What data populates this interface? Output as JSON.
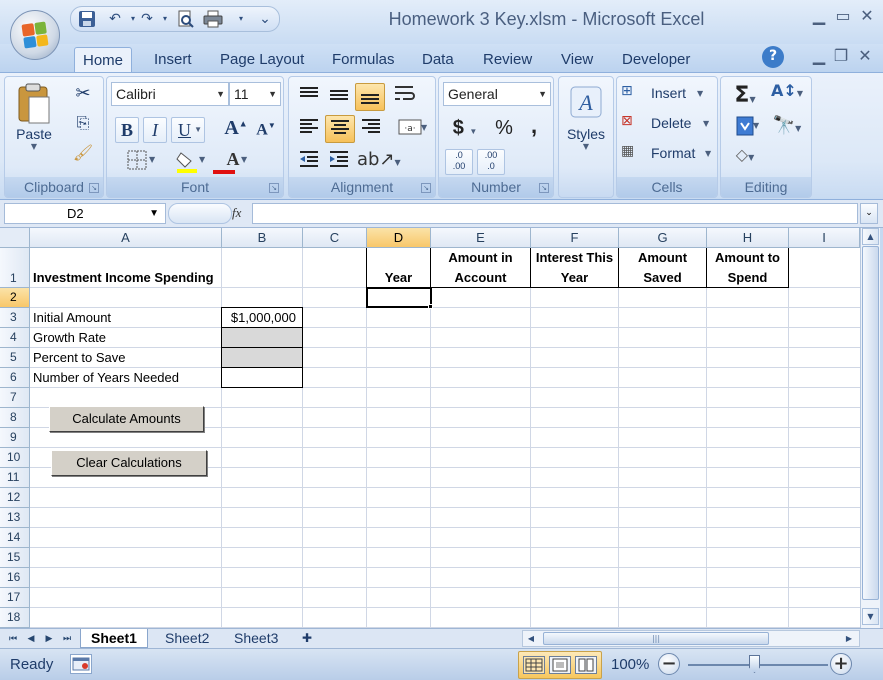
{
  "window": {
    "title": "Homework 3 Key.xlsm - Microsoft Excel"
  },
  "ribbon_tabs": [
    "Home",
    "Insert",
    "Page Layout",
    "Formulas",
    "Data",
    "Review",
    "View",
    "Developer"
  ],
  "ribbon": {
    "clipboard": {
      "label": "Clipboard",
      "paste": "Paste"
    },
    "font": {
      "label": "Font",
      "name": "Calibri",
      "size": "11",
      "bold": "B",
      "italic": "I",
      "underline": "U"
    },
    "alignment": {
      "label": "Alignment"
    },
    "number": {
      "label": "Number",
      "format": "General",
      "currency": "$",
      "percent": "%",
      "comma": ","
    },
    "styles": {
      "label": "Styles"
    },
    "cells": {
      "label": "Cells",
      "insert": "Insert",
      "delete": "Delete",
      "format": "Format"
    },
    "editing": {
      "label": "Editing"
    }
  },
  "formula_bar": {
    "name_box": "D2",
    "fx": "fx",
    "value": ""
  },
  "columns": [
    "A",
    "B",
    "C",
    "D",
    "E",
    "F",
    "G",
    "H",
    "I"
  ],
  "rows": [
    "1",
    "2",
    "3",
    "4",
    "5",
    "6",
    "7",
    "8",
    "9",
    "10",
    "11",
    "12",
    "13",
    "14",
    "15",
    "16",
    "17",
    "18"
  ],
  "cells": {
    "A1": "Investment Income Spending",
    "A3": "Initial Amount",
    "A4": "Growth Rate",
    "A5": "Percent to Save",
    "A6": "Number of Years Needed",
    "B3": "$1,000,000",
    "D1": "Year",
    "E1_line1": "Amount in",
    "E1_line2": "Account",
    "F1_line1": "Interest This",
    "F1_line2": "Year",
    "G1_line1": "Amount",
    "G1_line2": "Saved",
    "H1_line1": "Amount to",
    "H1_line2": "Spend"
  },
  "buttons": {
    "calculate": "Calculate Amounts",
    "clear": "Clear Calculations"
  },
  "sheet_tabs": [
    "Sheet1",
    "Sheet2",
    "Sheet3"
  ],
  "status": {
    "text": "Ready",
    "zoom": "100%"
  },
  "colors": {
    "selected_header": "#f8c76a",
    "input_grey": "#d9d9d9",
    "ribbon_blue": "#c5d9f1"
  }
}
